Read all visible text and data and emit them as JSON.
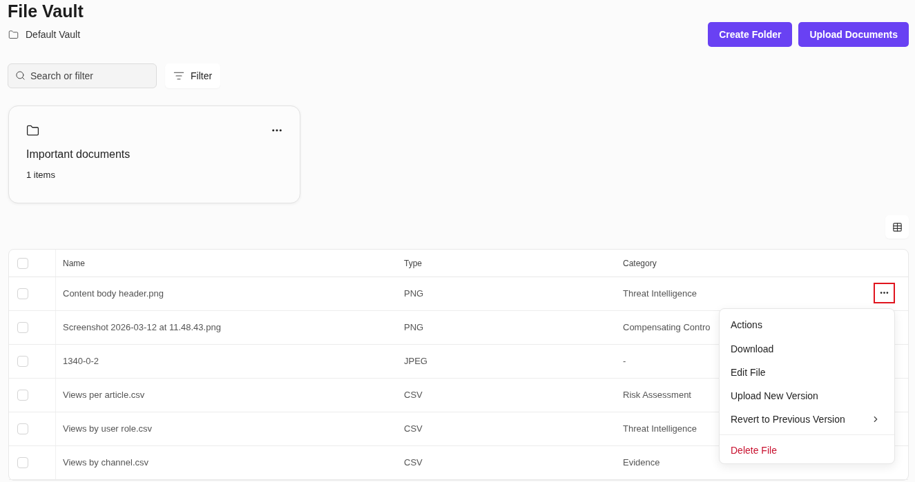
{
  "header": {
    "title": "File Vault",
    "breadcrumb": "Default Vault"
  },
  "actions": [
    "Create Folder",
    "Upload Documents"
  ],
  "search": {
    "placeholder": "Search or filter"
  },
  "filter_button": "Filter",
  "folders": [
    {
      "name": "Important documents",
      "count": "1 items"
    }
  ],
  "table": {
    "select_all": {
      "checked": false
    },
    "columns": [
      "Name",
      "Type",
      "Category"
    ],
    "rows": [
      {
        "checked": false,
        "menu_button": {
          "highlighted": true
        },
        "cells": [
          "Content body header.png",
          "PNG",
          "Threat Intelligence"
        ]
      },
      {
        "checked": false,
        "cells": [
          "Screenshot 2026-03-12 at 11.48.43.png",
          "PNG",
          "Compensating Contro"
        ]
      },
      {
        "checked": false,
        "cells": [
          "1340-0-2",
          "JPEG",
          "-"
        ]
      },
      {
        "checked": false,
        "cells": [
          "Views per article.csv",
          "CSV",
          "Risk Assessment"
        ]
      },
      {
        "checked": false,
        "cells": [
          "Views by user role.csv",
          "CSV",
          "Threat Intelligence"
        ]
      },
      {
        "checked": false,
        "cells": [
          "Views by channel.csv",
          "CSV",
          "Evidence"
        ]
      }
    ]
  },
  "context_menu": {
    "title": "Actions",
    "items": [
      {
        "label": "Download",
        "kind": "item"
      },
      {
        "label": "Edit File",
        "kind": "item"
      },
      {
        "label": "Upload New Version",
        "kind": "item"
      },
      {
        "label": "Revert to Previous Version",
        "kind": "submenu"
      },
      {
        "label": "Delete File",
        "kind": "danger"
      }
    ]
  }
}
